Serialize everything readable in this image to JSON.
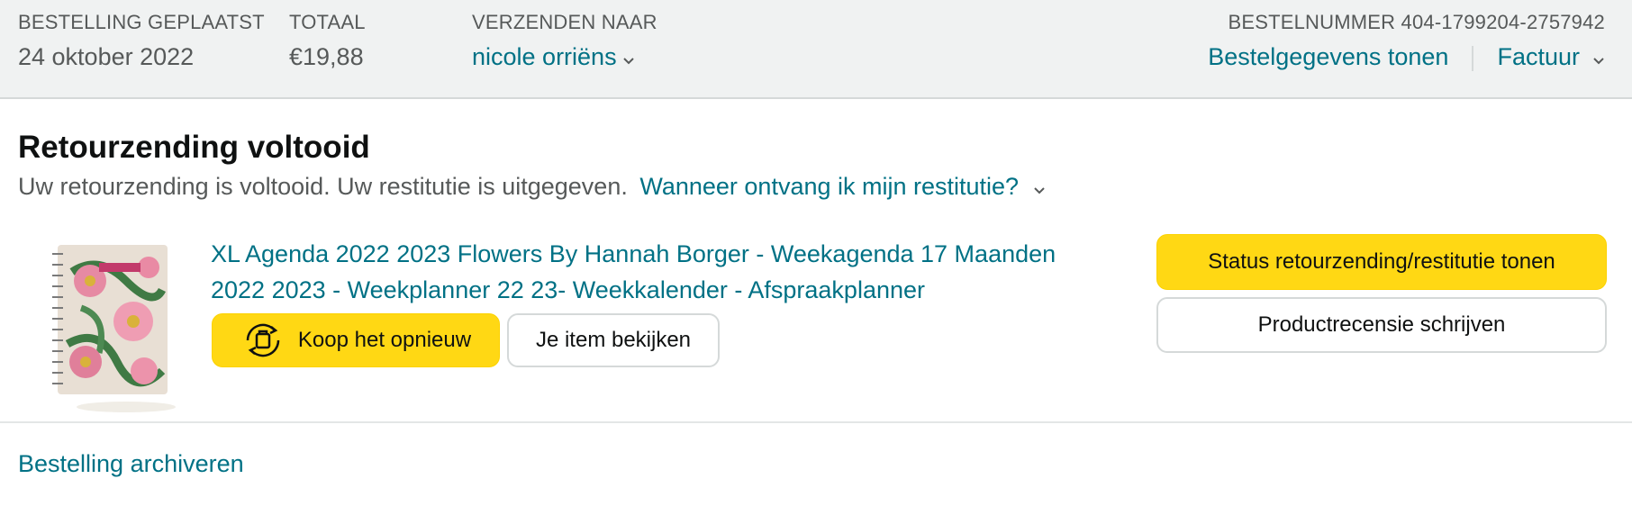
{
  "header": {
    "order_placed_label": "BESTELLING GEPLAATST",
    "order_placed_value": "24 oktober 2022",
    "total_label": "TOTAAL",
    "total_value": "€19,88",
    "ship_to_label": "VERZENDEN NAAR",
    "ship_to_value": "nicole orriëns",
    "order_number": "BESTELNUMMER 404-1799204-2757942",
    "details_link": "Bestelgegevens tonen",
    "invoice_link": "Factuur"
  },
  "status": {
    "title": "Retourzending voltooid",
    "message": "Uw retourzending is voltooid. Uw restitutie is uitgegeven.",
    "refund_link": "Wanneer ontvang ik mijn restitutie?"
  },
  "product": {
    "title": "XL Agenda 2022 2023 Flowers By Hannah Borger - Weekagenda 17 Maanden 2022 2023 - Weekplanner 22 23- Weekkalender - Afspraakplanner"
  },
  "buttons": {
    "buy_again": "Koop het opnieuw",
    "view_item": "Je item bekijken",
    "return_status": "Status retourzending/restitutie tonen",
    "write_review": "Productrecensie schrijven"
  },
  "footer": {
    "archive_link": "Bestelling archiveren"
  },
  "icons": {
    "chevron": "chevron-down-icon",
    "buy_again": "reorder-icon"
  },
  "colors": {
    "link": "#007185",
    "primary_button": "#FFD814",
    "header_bg": "#F0F2F2"
  }
}
